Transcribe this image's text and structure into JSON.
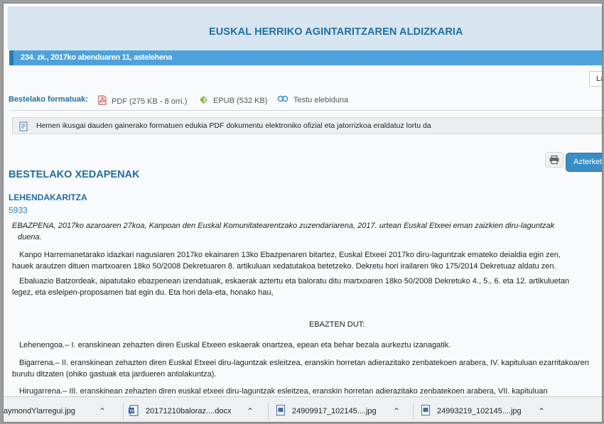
{
  "header": {
    "title": "EUSKAL HERRIKO AGINTARITZAREN ALDIZKARIA",
    "issue": "234. zk., 2017ko abenduaren 11, astelehena",
    "lang_tab": "La"
  },
  "formats": {
    "label": "Bestelako formatuak:",
    "pdf": "PDF (275 KB - 8 orri.)",
    "epub": "EPUB (532 KB)",
    "text": "Testu elebiduna"
  },
  "notice": "Hemen ikusgai dauden gainerako formatuen edukia PDF dokumentu elektroniko ofizial eta jatorrizkoa eraldatuz lortu da",
  "toolbar": {
    "examine_label": "Azterketa"
  },
  "content": {
    "section": "BESTELAKO XEDAPENAK",
    "department": "LEHENDAKARITZA",
    "number": "5933",
    "summary_line1": "EBAZPENA, 2017ko azaroaren 27koa, Kanpoan den Euskal Komunitatearentzako zuzendariarena, 2017. urtean Euskal Etxeei eman zaizkien diru-laguntzak",
    "summary_line2": "duena.",
    "p1_line1": "Kanpo Harremanetarako idazkari nagusiaren 2017ko ekainaren 13ko Ebazpenaren bitartez, Euskal Etxeei 2017ko diru-laguntzak emateko deialdia egin zen,",
    "p1_line2": "hauek arautzen dituen martxoaren 18ko 50/2008 Dekretuaren 8. artikuluan xedatutakoa betetzeko. Dekretu hori irailaren 9ko 175/2014 Dekretuaz aldatu zen.",
    "p2_line1": "Ebaluazio Batzordeak, aipatutako ebazpenean izendatuak, eskaerak aztertu eta baloratu ditu martxoaren 18ko 50/2008 Dekretuko 4., 5., 6. eta 12. artikuluetan",
    "p2_line2": "legez, eta esleipen-proposamen bat egin du. Eta hori dela-eta, honako hau,",
    "resolve": "EBAZTEN DUT:",
    "first": "Lehenengoa.– I. eranskinean zehazten diren Euskal Etxeen eskaerak onartzea, epean eta behar bezala aurkeztu izanagatik.",
    "second_line1": "Bigarrena.– II. eranskinean zehazten diren Euskal Etxeei diru-laguntzak esleitzea, eranskin horretan adierazitako zenbatekoen arabera, IV. kapituluan ezarritakoaren",
    "second_line2": "burutu ditzaten (ohiko gastuak eta jardueren antolakuntza).",
    "third": "Hirugarrena.– III. eranskinean zehazten diren euskal etxeei diru-laguntzak esleitzea, eranskin horretan adierazitako zenbatekoen arabera, VII. kapituluan"
  },
  "downloads": [
    {
      "name": "aymondYlarregui.jpg",
      "icon": "image-file-icon"
    },
    {
      "name": "20171210baloraz....docx",
      "icon": "word-file-icon"
    },
    {
      "name": "24909917_102145....jpg",
      "icon": "image-file-icon"
    },
    {
      "name": "24993219_102145....jpg",
      "icon": "image-file-icon"
    }
  ],
  "colors": {
    "accent": "#1f6ea4",
    "issue_bar": "#4da2db",
    "button": "#3a8ec8"
  }
}
